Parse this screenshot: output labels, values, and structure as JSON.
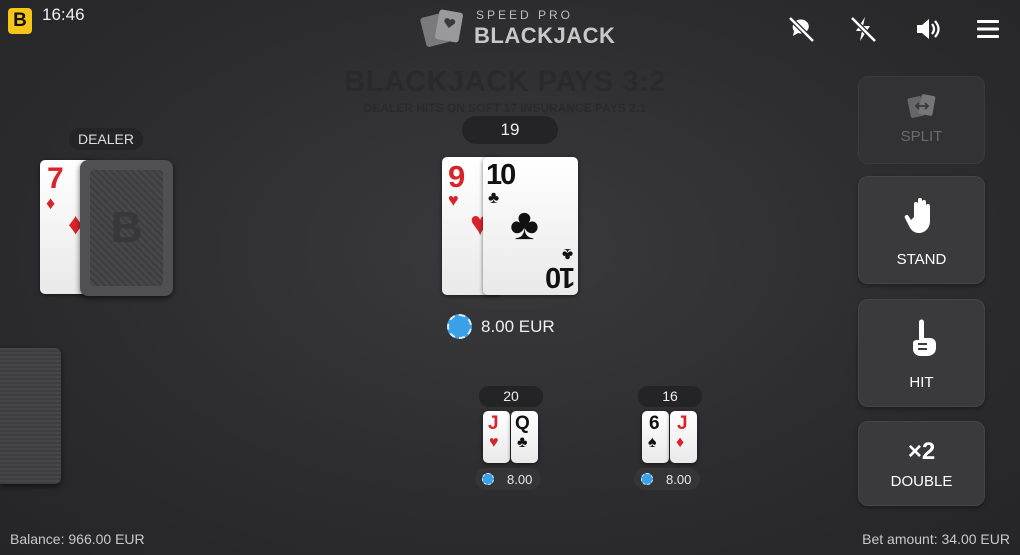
{
  "status_bar": {
    "brand_letter": "B",
    "time": "16:46"
  },
  "logo": {
    "top": "SPEED PRO",
    "main": "BLACKJACK"
  },
  "top_icons": [
    "no-chat-icon",
    "no-flash-icon",
    "volume-icon",
    "menu-icon"
  ],
  "table": {
    "pays_title": "BLACKJACK PAYS 3:2",
    "pays_sub": "DEALER HITS ON SOFT 17 INSURANCE PAYS 2:1"
  },
  "dealer": {
    "label": "DEALER",
    "upcard": {
      "rank": "7",
      "suit": "♦",
      "color": "red"
    },
    "hole_card_letter": "B"
  },
  "main_hand": {
    "score": "19",
    "cards": [
      {
        "rank": "9",
        "suit": "♥",
        "color": "red"
      },
      {
        "rank": "10",
        "suit": "♣",
        "color": "black"
      }
    ],
    "bet": "8.00 EUR"
  },
  "side_hands": [
    {
      "score": "20",
      "cards": [
        {
          "rank": "J",
          "suit": "♥",
          "color": "red"
        },
        {
          "rank": "Q",
          "suit": "♣",
          "color": "black"
        }
      ],
      "bet": "8.00"
    },
    {
      "score": "16",
      "cards": [
        {
          "rank": "6",
          "suit": "♠",
          "color": "black"
        },
        {
          "rank": "J",
          "suit": "♦",
          "color": "red"
        }
      ],
      "bet": "8.00"
    }
  ],
  "actions": {
    "split": {
      "label": "SPLIT",
      "enabled": false
    },
    "stand": {
      "label": "STAND",
      "enabled": true
    },
    "hit": {
      "label": "HIT",
      "enabled": true
    },
    "double": {
      "label": "DOUBLE",
      "badge": "×2",
      "enabled": true
    }
  },
  "footer": {
    "balance": "Balance: 966.00 EUR",
    "bet_amount": "Bet amount: 34.00 EUR"
  },
  "colors": {
    "brand": "#f5c518",
    "chip": "#3aa0e8",
    "card_red": "#d8232a",
    "background": "#2c2c2e"
  }
}
